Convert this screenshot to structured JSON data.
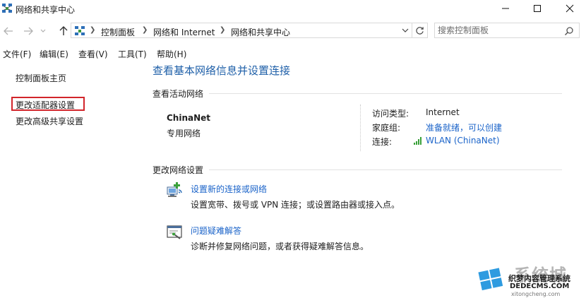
{
  "window": {
    "title": "网络和共享中心"
  },
  "address_bar": {
    "breadcrumbs": [
      "控制面板",
      "网络和 Internet",
      "网络和共享中心"
    ]
  },
  "search": {
    "placeholder": "搜索控制面板"
  },
  "menu": {
    "items": [
      "文件(F)",
      "编辑(E)",
      "查看(V)",
      "工具(T)",
      "帮助(H)"
    ]
  },
  "sidebar": {
    "home": "控制面板主页",
    "adapter_settings": "更改适配器设置",
    "advanced_sharing": "更改高级共享设置"
  },
  "main": {
    "heading": "查看基本网络信息并设置连接",
    "active_networks_label": "查看活动网络",
    "network": {
      "name": "ChinaNet",
      "category": "专用网络",
      "access_type_label": "访问类型:",
      "access_type_value": "Internet",
      "homegroup_label": "家庭组:",
      "homegroup_value": "准备就绪，可以创建",
      "connections_label": "连接:",
      "connections_value": "WLAN (ChinaNet)"
    },
    "change_settings_label": "更改网络设置",
    "tasks": [
      {
        "title": "设置新的连接或网络",
        "desc": "设置宽带、拨号或 VPN 连接；或设置路由器或接入点。"
      },
      {
        "title": "问题疑难解答",
        "desc": "诊断并修复网络问题，或者获得疑难解答信息。"
      }
    ]
  },
  "watermark": {
    "brand": "系统城",
    "line1": "织梦内容管理系统",
    "line2": "DEDECMS.COM",
    "line3": "xitongcheng.com"
  },
  "colors": {
    "link": "#1a63c9",
    "heading": "#1e5fa8",
    "highlight_box": "#d2252b"
  }
}
